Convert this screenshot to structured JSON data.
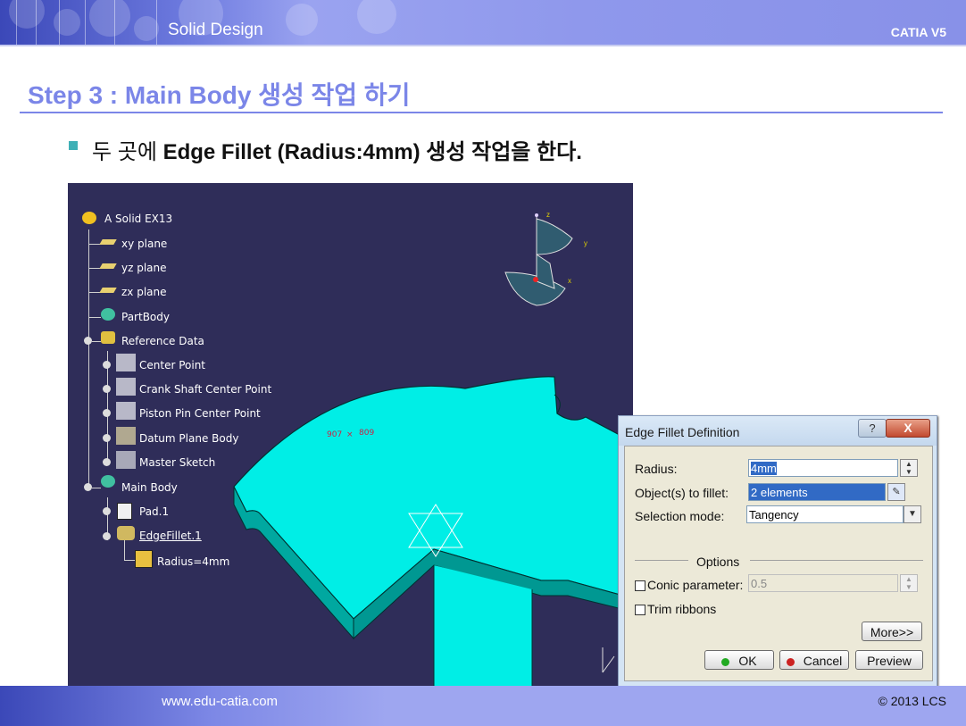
{
  "header": {
    "title": "Solid Design",
    "right": "CATIA V5"
  },
  "step_title": "Step 3 : Main Body 생성 작업 하기",
  "bullet": {
    "pre": "두 곳에 ",
    "bold": "Edge Fillet (Radius:4mm)",
    "post": " 생성 작업을 한다."
  },
  "tree": {
    "root": "A Solid EX13",
    "items": [
      "xy plane",
      "yz plane",
      "zx plane",
      "PartBody",
      "Reference Data",
      "Center Point",
      "Crank Shaft Center Point",
      "Piston Pin Center Point",
      "Datum Plane Body",
      "Master Sketch",
      "Main Body",
      "Pad.1",
      "EdgeFillet.1",
      "Radius=4mm"
    ]
  },
  "viewport": {
    "point_label_a": "907",
    "point_label_b": "809",
    "axis_z": "z",
    "axis_y": "y",
    "axis_x": "x"
  },
  "dialog": {
    "title": "Edge Fillet Definition",
    "help": "?",
    "close": "X",
    "radius_label": "Radius:",
    "radius_value": "4mm",
    "objects_label": "Object(s) to fillet:",
    "objects_value": "2 elements",
    "selection_label": "Selection mode:",
    "selection_value": "Tangency",
    "options_label": "Options",
    "conic_label": "Conic parameter:",
    "conic_value": "0.5",
    "trim_label": "Trim ribbons",
    "more_button": "More>>",
    "ok_button": "OK",
    "cancel_button": "Cancel",
    "preview_button": "Preview"
  },
  "footer": {
    "url": "www.edu-catia.com",
    "copyright": "© 2013 LCS"
  },
  "colors": {
    "accent": "#7b86e8",
    "part": "#00e8e0",
    "viewport_bg": "#2f2d59"
  }
}
